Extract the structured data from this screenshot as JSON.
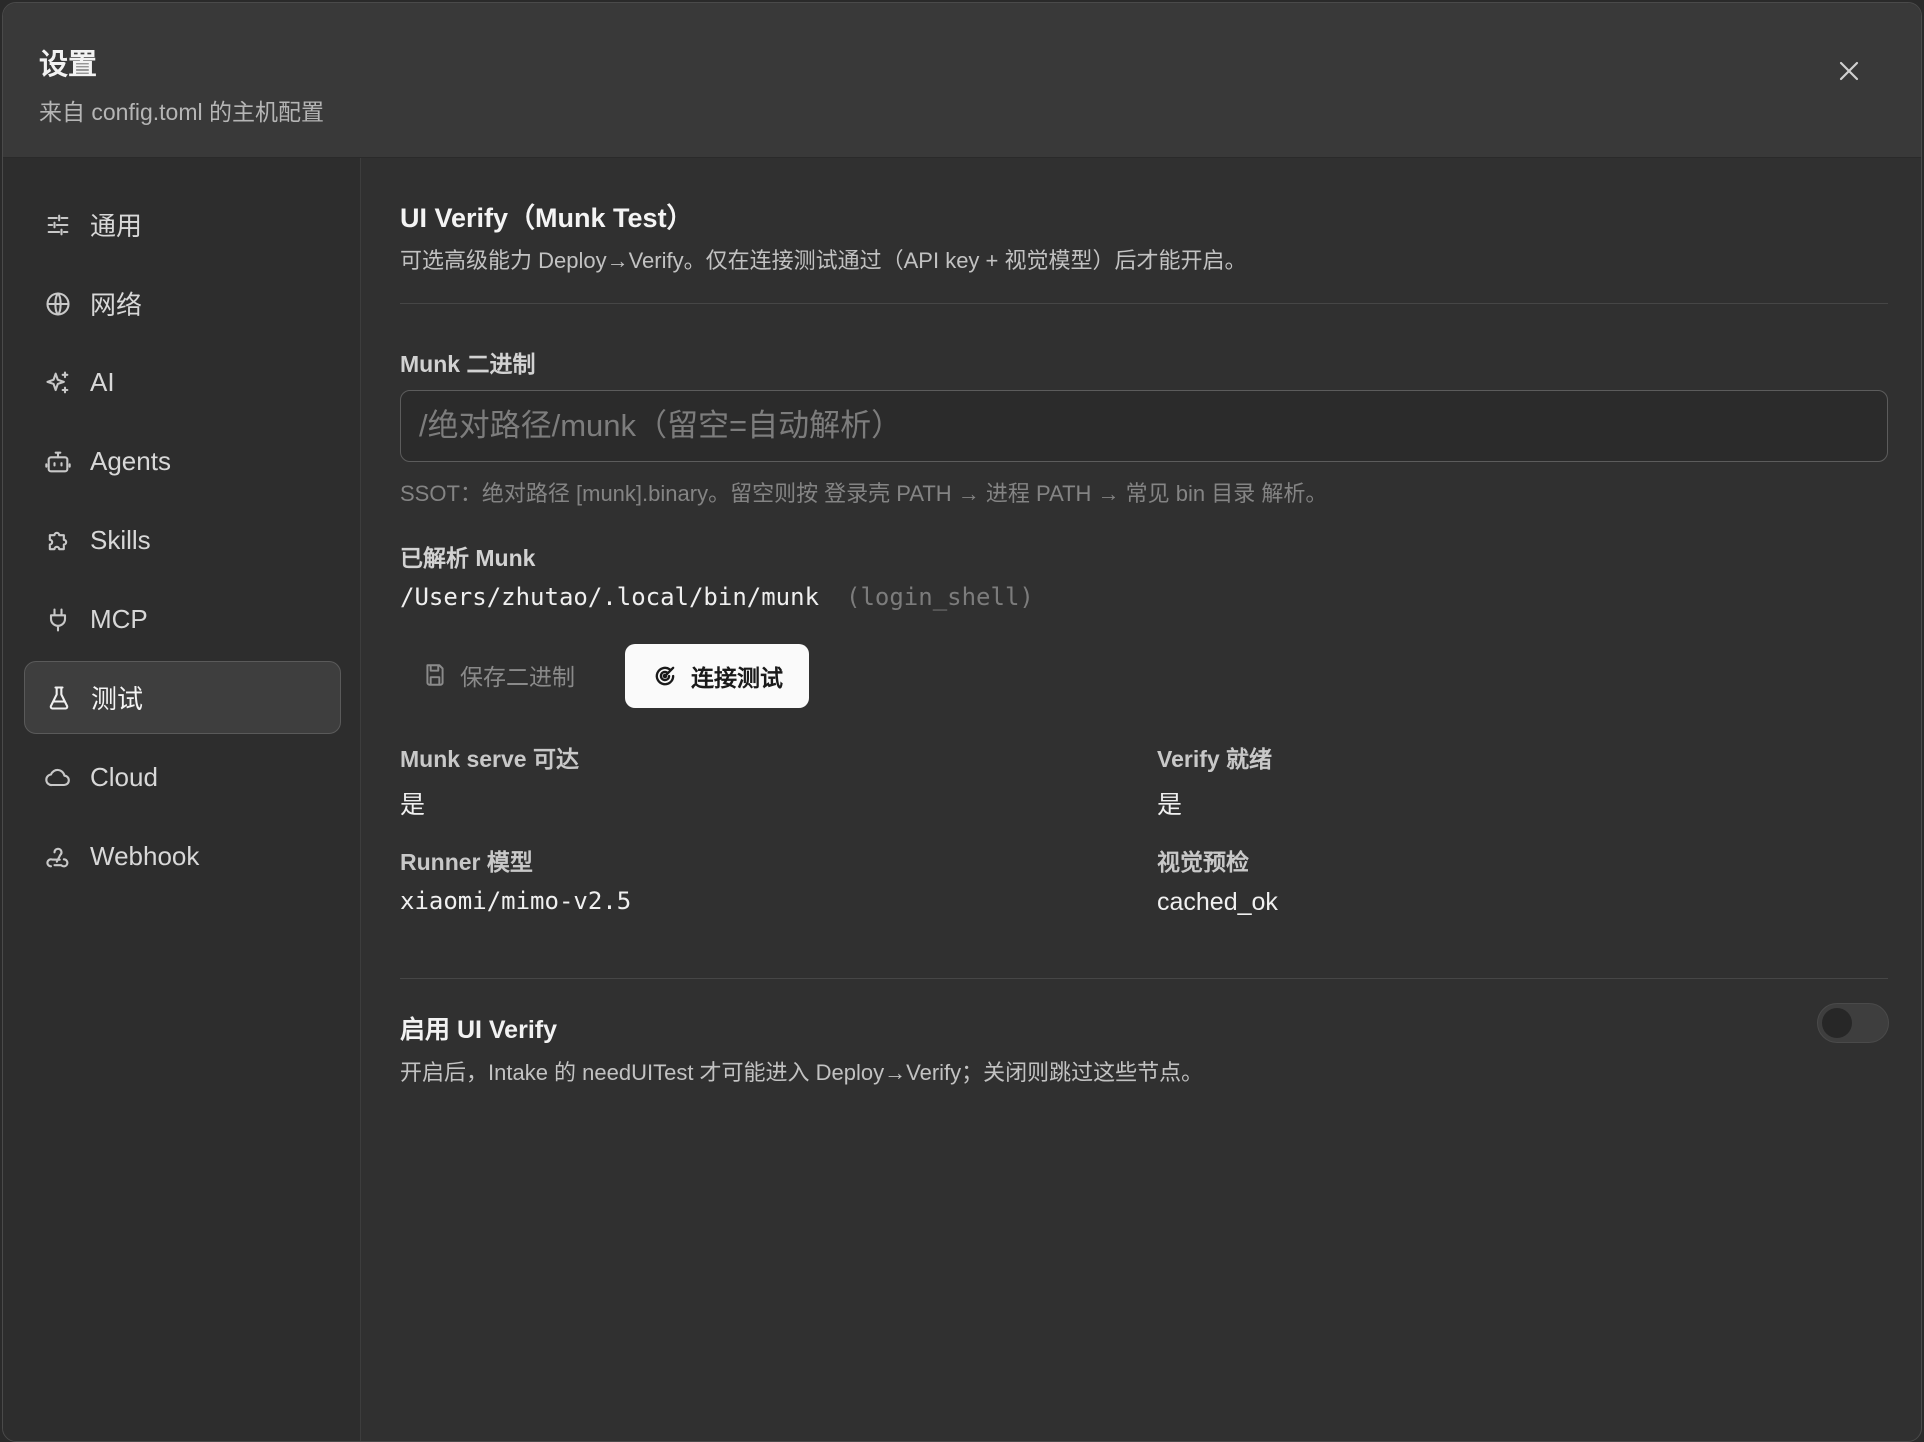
{
  "header": {
    "title": "设置",
    "subtitle": "来自 config.toml 的主机配置"
  },
  "sidebar": {
    "items": [
      {
        "label": "通用",
        "icon": "sliders-icon"
      },
      {
        "label": "网络",
        "icon": "globe-icon"
      },
      {
        "label": "AI",
        "icon": "sparkles-icon"
      },
      {
        "label": "Agents",
        "icon": "bot-icon"
      },
      {
        "label": "Skills",
        "icon": "puzzle-icon"
      },
      {
        "label": "MCP",
        "icon": "plug-icon"
      },
      {
        "label": "测试",
        "icon": "flask-icon",
        "active": true
      },
      {
        "label": "Cloud",
        "icon": "cloud-icon"
      },
      {
        "label": "Webhook",
        "icon": "webhook-icon"
      }
    ]
  },
  "main": {
    "title": "UI Verify（Munk Test）",
    "description": "可选高级能力 Deploy→Verify。仅在连接测试通过（API key + 视觉模型）后才能开启。",
    "binary": {
      "label": "Munk 二进制",
      "value": "",
      "placeholder": "/绝对路径/munk（留空=自动解析）",
      "hint": "SSOT：绝对路径 [munk].binary。留空则按 登录壳 PATH → 进程 PATH → 常见 bin 目录 解析。"
    },
    "resolved": {
      "label": "已解析 Munk",
      "path": "/Users/zhutao/.local/bin/munk",
      "source": "(login_shell)"
    },
    "buttons": {
      "save": "保存二进制",
      "test": "连接测试"
    },
    "stats": {
      "serve_label": "Munk serve 可达",
      "serve_value": "是",
      "verify_label": "Verify 就绪",
      "verify_value": "是",
      "runner_label": "Runner 模型",
      "runner_value": "xiaomi/mimo-v2.5",
      "vision_label": "视觉预检",
      "vision_value": "cached_ok"
    },
    "enable": {
      "title": "启用 UI Verify",
      "description": "开启后，Intake 的 needUITest 才可能进入 Deploy→Verify；关闭则跳过这些节点。",
      "enabled": false
    }
  }
}
